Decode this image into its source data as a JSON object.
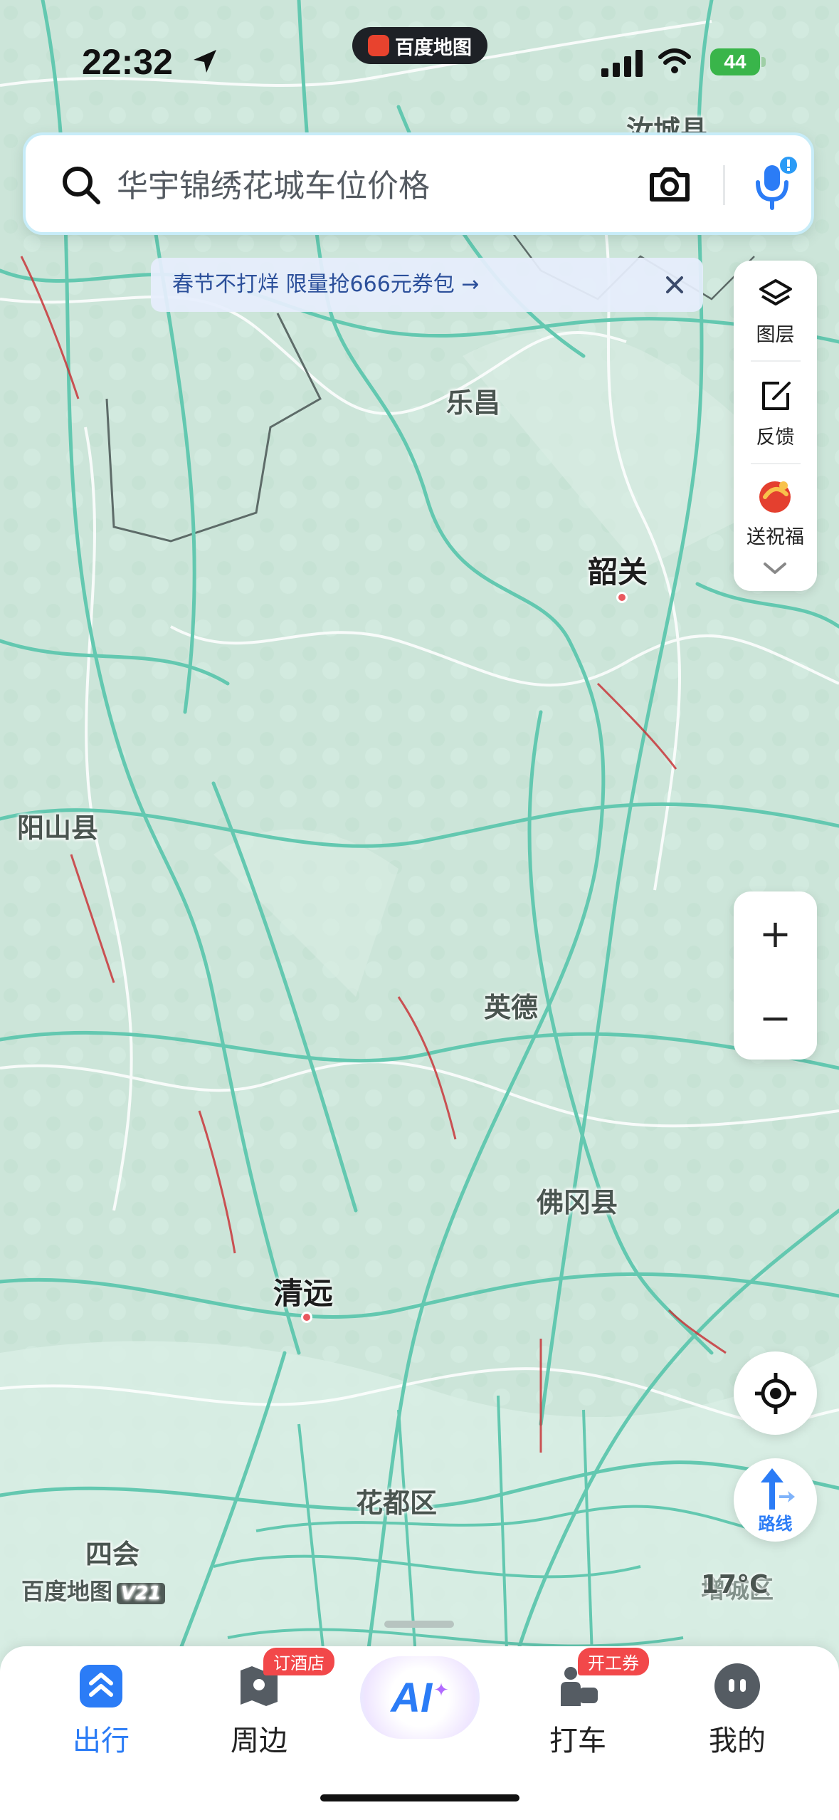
{
  "status_bar": {
    "time": "22:32",
    "battery": "44"
  },
  "app_pill": {
    "label": "百度地图"
  },
  "search": {
    "placeholder": "华宇锦绣花城车位价格"
  },
  "promo": {
    "text": "春节不打烊 限量抢666元券包 →"
  },
  "tools": {
    "layers_label": "图层",
    "feedback_label": "反馈",
    "blessing_label": "送祝福"
  },
  "zoom": {
    "in": "+",
    "out": "−"
  },
  "route_label": "路线",
  "map_labels": {
    "ruyuan": "汝城县",
    "lechang": "乐昌",
    "shaoguan": "韶关",
    "yangshan": "阳山县",
    "yingde": "英德",
    "fogang": "佛冈县",
    "qingyuan": "清远",
    "huadu": "花都区",
    "sihui": "四会",
    "zengcheng": "增城区"
  },
  "brand": {
    "name": "百度地图",
    "version": "V21"
  },
  "weather": "17°C",
  "bottom_nav": [
    {
      "label": "出行",
      "badge": "",
      "color": "#2b7cf6"
    },
    {
      "label": "周边",
      "badge": "订酒店",
      "color": "#222222"
    },
    {
      "label": "AI",
      "badge": "",
      "color": "#2b7cf6"
    },
    {
      "label": "打车",
      "badge": "开工券",
      "color": "#222222"
    },
    {
      "label": "我的",
      "badge": "",
      "color": "#222222"
    }
  ],
  "colors": {
    "accent": "#2b7cf6",
    "road": "#6fcfb8",
    "map_bg": "#cfe8dd",
    "badge": "#f2484a",
    "congestion": "#c8363a"
  }
}
